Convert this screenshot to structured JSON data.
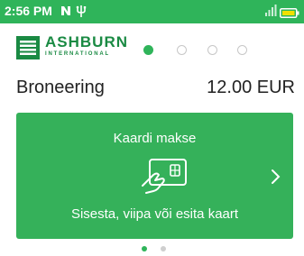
{
  "status_bar": {
    "time": "2:56 PM",
    "notification_icons": [
      "n-icon",
      "usb-icon"
    ],
    "signal_icon": "signal-icon",
    "battery_icon": "battery-icon",
    "color": "#2fb45a"
  },
  "logo": {
    "name": "ASHBURN",
    "subtitle": "INTERNATIONAL"
  },
  "steps": {
    "total": 4,
    "current": 1
  },
  "booking": {
    "label": "Broneering",
    "amount": "12.00 EUR"
  },
  "card_payment": {
    "title": "Kaardi makse",
    "instruction": "Sisesta, viipa või esita kaart",
    "icon": "card-in-hand-icon",
    "arrow_icon": "chevron-right-icon",
    "color": "#35b15a"
  },
  "pager": {
    "total": 2,
    "current": 1
  }
}
